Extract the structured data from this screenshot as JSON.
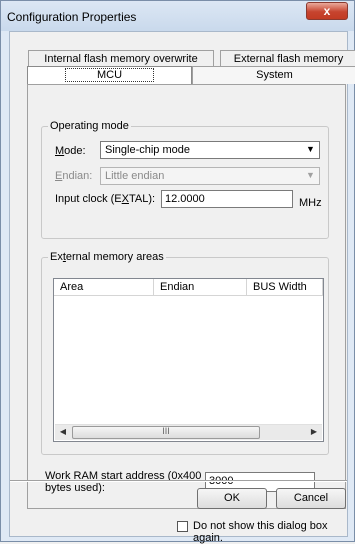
{
  "window": {
    "title": "Configuration Properties",
    "close_glyph": "x"
  },
  "tabs": {
    "row1": [
      {
        "label": "Internal flash memory overwrite"
      },
      {
        "label": "External flash memory"
      }
    ],
    "row2": [
      {
        "label": "MCU",
        "active": true
      },
      {
        "label": "System",
        "active": false
      }
    ]
  },
  "operating_mode": {
    "group_label": "Operating mode",
    "mode_label_prefix": "",
    "mode_label_accel": "M",
    "mode_label_rest": "ode:",
    "mode_value": "Single-chip mode",
    "endian_label_accel": "E",
    "endian_label_rest": "ndian:",
    "endian_value": "Little endian",
    "clock_label_pre": "Input clock (E",
    "clock_label_accel": "X",
    "clock_label_post": "TAL):",
    "clock_value": "12.0000",
    "clock_unit": "MHz"
  },
  "external_memory": {
    "group_label_pre": "Ex",
    "group_label_accel": "t",
    "group_label_post": "ernal memory areas",
    "columns": [
      "Area",
      "Endian",
      "BUS Width"
    ],
    "rows": [],
    "scroll_thumb_glyph": "III"
  },
  "work_ram": {
    "label_line1_pre": "Work ",
    "label_line1_accel": "R",
    "label_line1_post": "AM start address (0x400",
    "label_line2": "bytes used):",
    "value": "3000"
  },
  "buttons": {
    "ok": "OK",
    "cancel": "Cancel"
  },
  "footer": {
    "dont_show_label": "Do not show this dialog box again.",
    "checked": false
  },
  "colors": {
    "title_bg": "#dce7f4",
    "close_red": "#c7442f",
    "dialog_bg": "#f0f0f0"
  }
}
